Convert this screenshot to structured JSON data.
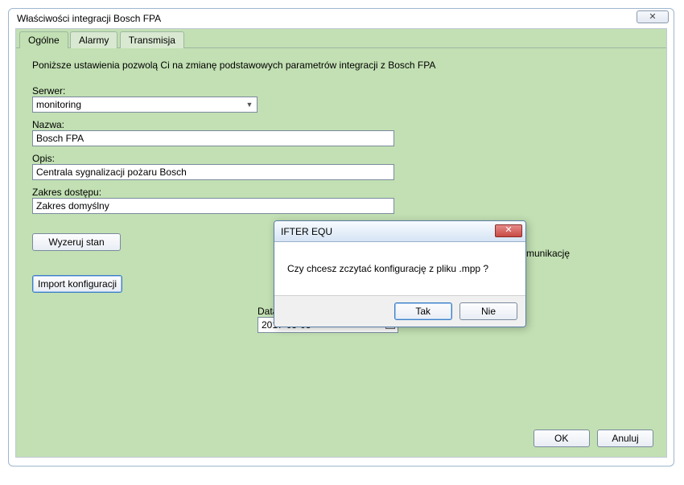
{
  "window": {
    "title": "Właściwości integracji Bosch FPA",
    "close_glyph": "✕"
  },
  "tabs": {
    "general": "Ogólne",
    "alarms": "Alarmy",
    "transmission": "Transmisja"
  },
  "panel": {
    "intro": "Poniższe ustawienia pozwolą Ci na zmianę podstawowych parametrów integracji z Bosch FPA",
    "server_label": "Serwer:",
    "server_value": "monitoring",
    "name_label": "Nazwa:",
    "name_value": "Bosch FPA",
    "desc_label": "Opis:",
    "desc_value": "Centrala sygnalizacji pożaru Bosch",
    "scope_label": "Zakres dostępu:",
    "scope_value": "Zakres domyślny",
    "reset_btn": "Wyzeruj stan",
    "import_btn": "Import konfiguracji",
    "background_comm": "z komunikację",
    "date_label": "Data początku konserwacji",
    "date_value": "2017-05-08"
  },
  "footer": {
    "ok": "OK",
    "cancel": "Anuluj"
  },
  "modal": {
    "title": "IFTER EQU",
    "close_glyph": "✕",
    "message": "Czy chcesz zczytać konfigurację z pliku .mpp ?",
    "yes": "Tak",
    "no": "Nie"
  }
}
